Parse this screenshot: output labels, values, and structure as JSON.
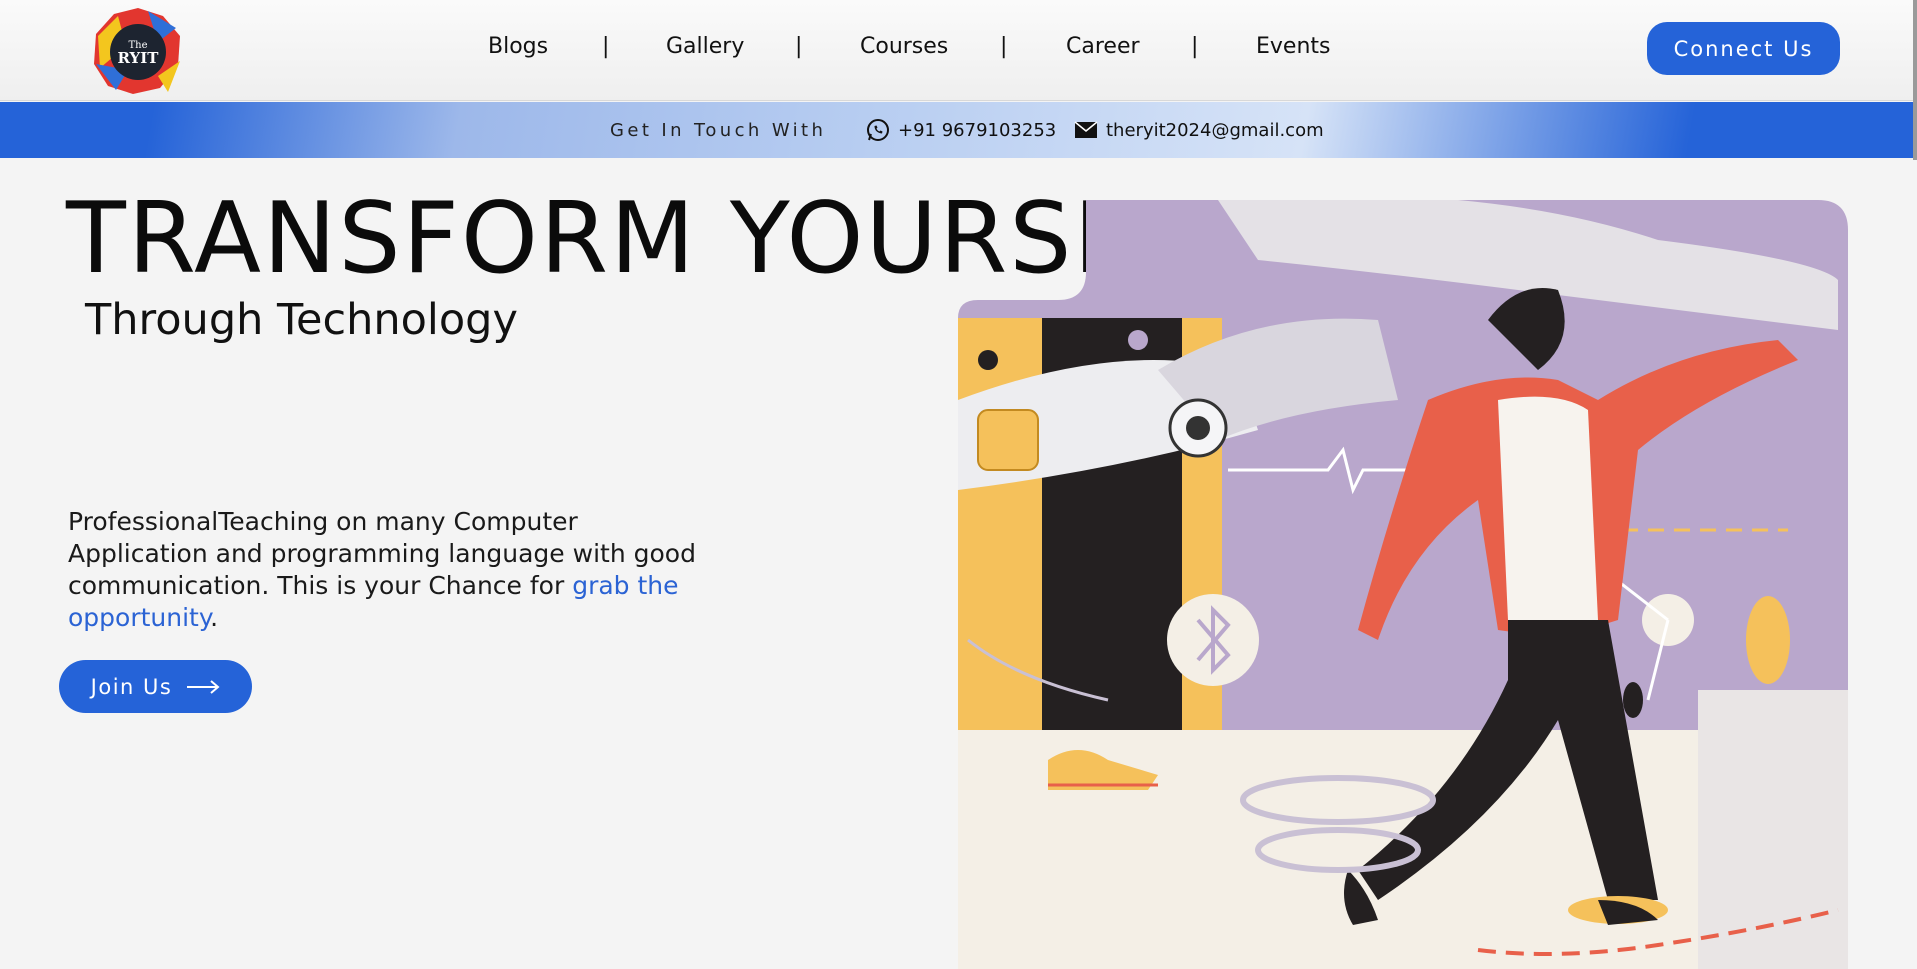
{
  "brand": {
    "logo_line1": "The",
    "logo_line2": "RYIT"
  },
  "nav": {
    "items": [
      {
        "label": "Blogs"
      },
      {
        "label": "Gallery"
      },
      {
        "label": "Courses"
      },
      {
        "label": "Career"
      },
      {
        "label": "Events"
      }
    ],
    "separator": "|"
  },
  "header": {
    "connect_label": "Connect Us"
  },
  "contact": {
    "label": "Get In Touch With",
    "phone": "+91 9679103253",
    "email": "theryit2024@gmail.com",
    "phone_icon": "whatsapp-icon",
    "email_icon": "mail-icon"
  },
  "hero": {
    "title": "TRANSFORM YOURSELF",
    "subtitle": "Through Technology",
    "desc_text": "ProfessionalTeaching on many Computer Application and programming language with good communication. This is your Chance for ",
    "desc_link": "grab the opportunity",
    "desc_end": ".",
    "join_label": "Join Us"
  },
  "colors": {
    "accent": "#2563d8",
    "link": "#2b63d4",
    "art_purple": "#b9a7cc",
    "art_orange": "#e8604a",
    "art_yellow": "#f5c15b"
  }
}
